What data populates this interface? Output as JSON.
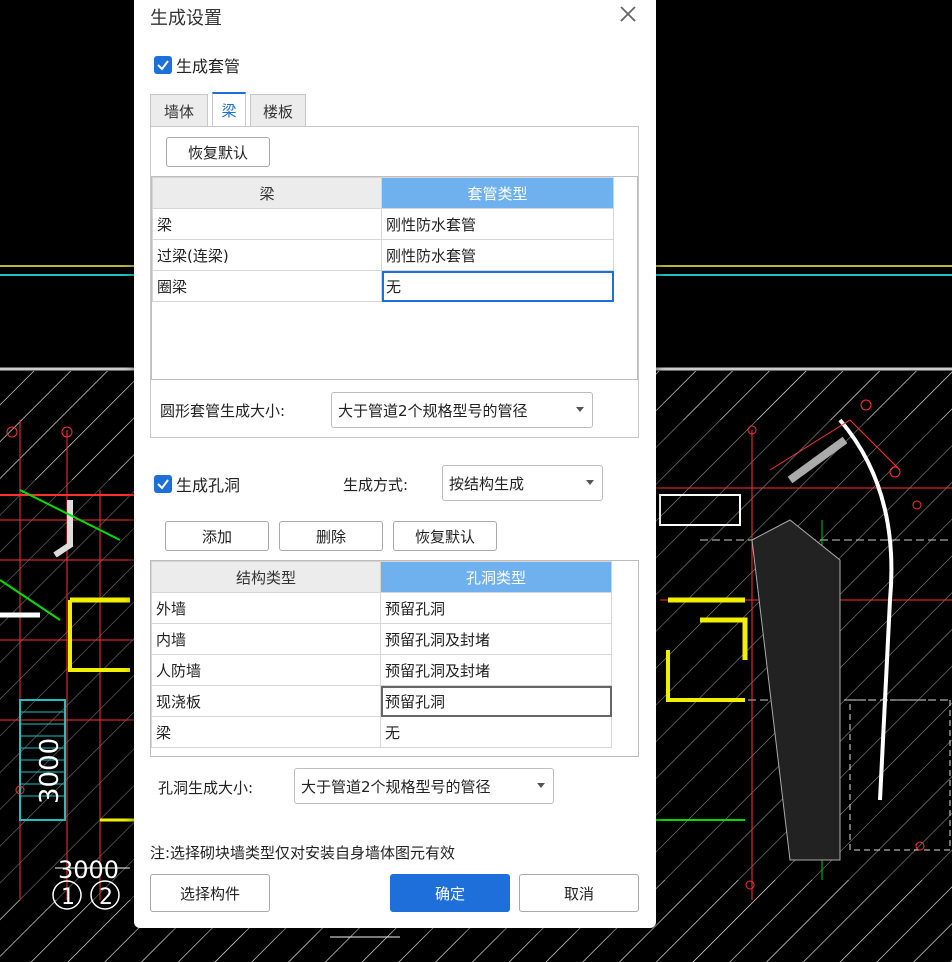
{
  "dialog": {
    "title": "生成设置",
    "close_label": "close"
  },
  "sleeve": {
    "checkbox_label": "生成套管",
    "checked": true,
    "tabs": [
      {
        "label": "墙体",
        "active": false
      },
      {
        "label": "梁",
        "active": true
      },
      {
        "label": "楼板",
        "active": false
      }
    ],
    "restore_label": "恢复默认",
    "grid": {
      "headers": [
        "梁",
        "套管类型"
      ],
      "rows": [
        [
          "梁",
          "刚性防水套管"
        ],
        [
          "过梁(连梁)",
          "刚性防水套管"
        ],
        [
          "圈梁",
          "无"
        ]
      ]
    },
    "size_label": "圆形套管生成大小:",
    "size_value": "大于管道2个规格型号的管径"
  },
  "hole": {
    "checkbox_label": "生成孔洞",
    "checked": true,
    "method_label": "生成方式:",
    "method_value": "按结构生成",
    "add_label": "添加",
    "delete_label": "删除",
    "restore_label": "恢复默认",
    "grid": {
      "headers": [
        "结构类型",
        "孔洞类型"
      ],
      "rows": [
        [
          "外墙",
          "预留孔洞"
        ],
        [
          "内墙",
          "预留孔洞及封堵"
        ],
        [
          "人防墙",
          "预留孔洞及封堵"
        ],
        [
          "现浇板",
          "预留孔洞"
        ],
        [
          "梁",
          "无"
        ]
      ]
    },
    "size_label": "孔洞生成大小:",
    "size_value": "大于管道2个规格型号的管径"
  },
  "note": "注:选择砌块墙类型仅对安装自身墙体图元有效",
  "footer": {
    "select_label": "选择构件",
    "ok_label": "确定",
    "cancel_label": "取消"
  },
  "cad_labels": {
    "dim_vertical": "3000",
    "dim_horizontal": "3000",
    "axis_1": "1",
    "axis_2": "2"
  },
  "colors": {
    "accent": "#1e6fd9",
    "header_selected": "#6fb1ee"
  }
}
